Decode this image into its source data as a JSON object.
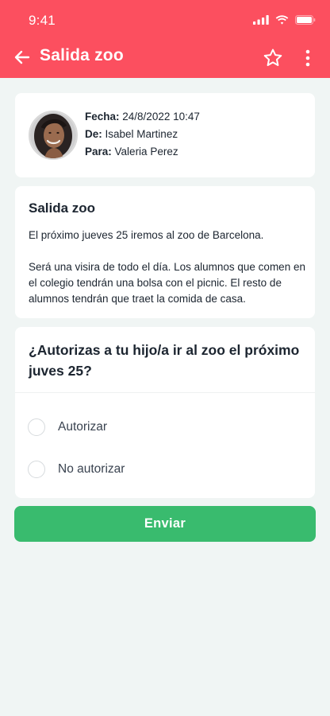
{
  "status_bar": {
    "time": "9:41"
  },
  "header": {
    "title": "Salida zoo"
  },
  "meta": {
    "date_label": "Fecha:",
    "date_value": "24/8/2022 10:47",
    "from_label": "De:",
    "from_value": "Isabel Martinez",
    "to_label": "Para:",
    "to_value": "Valeria Perez"
  },
  "message": {
    "title": "Salida zoo",
    "paragraphs": [
      "El próximo jueves 25 iremos al zoo de Barcelona.",
      "Será una visira de todo el día. Los alumnos que comen en el colegio tendrán una bolsa con el picnic. El resto de alumnos tendrán que traet la comida de casa."
    ]
  },
  "question": {
    "title": "¿Autorizas a tu hijo/a ir al zoo el próximo juves 25?",
    "options": [
      {
        "label": "Autorizar"
      },
      {
        "label": "No autorizar"
      }
    ]
  },
  "actions": {
    "send_label": "Enviar"
  },
  "colors": {
    "header": "#fc4f5f",
    "button": "#39bb6e",
    "background": "#f0f5f4"
  }
}
